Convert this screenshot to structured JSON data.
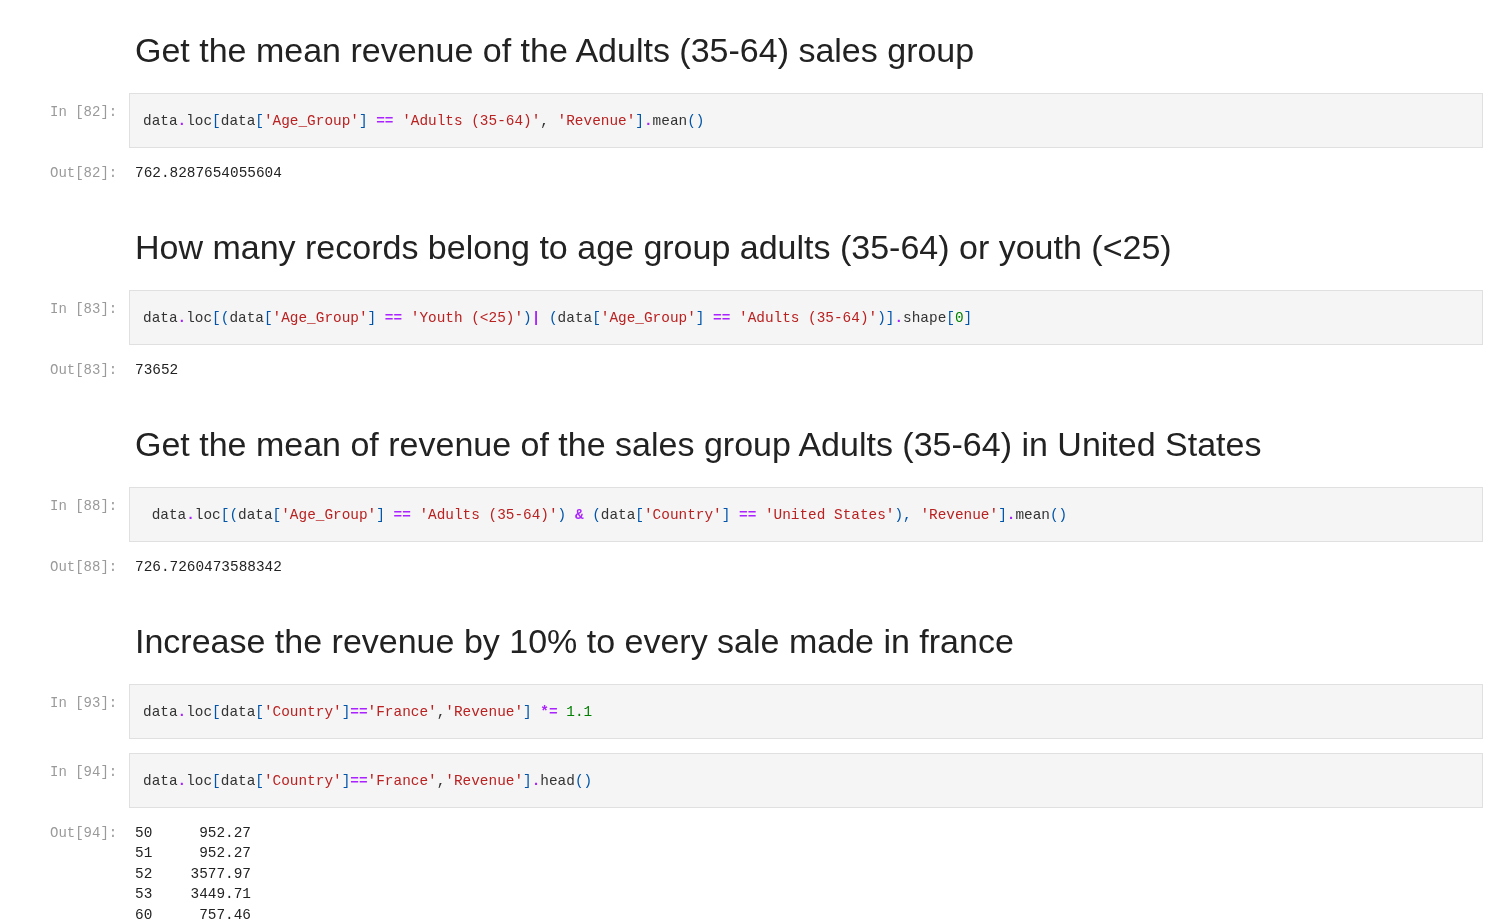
{
  "cells": [
    {
      "kind": "markdown",
      "text": "Get the mean revenue of the Adults (35-64) sales group"
    },
    {
      "kind": "code",
      "prompt": "In [82]:",
      "tokens": [
        {
          "kind": "name",
          "text": "data"
        },
        {
          "kind": "op",
          "text": "."
        },
        {
          "kind": "name",
          "text": "loc"
        },
        {
          "kind": "punc",
          "text": "["
        },
        {
          "kind": "name",
          "text": "data"
        },
        {
          "kind": "punc",
          "text": "["
        },
        {
          "kind": "str",
          "text": "'Age_Group'"
        },
        {
          "kind": "punc",
          "text": "] "
        },
        {
          "kind": "op",
          "text": "=="
        },
        {
          "kind": "str",
          "text": " 'Adults (35-64)'"
        },
        {
          "kind": "name",
          "text": ", "
        },
        {
          "kind": "str",
          "text": "'Revenue'"
        },
        {
          "kind": "punc",
          "text": "]"
        },
        {
          "kind": "op",
          "text": "."
        },
        {
          "kind": "name",
          "text": "mean"
        },
        {
          "kind": "punc",
          "text": "()"
        }
      ],
      "output": {
        "prompt": "Out[82]:",
        "lines": [
          "762.8287654055604"
        ]
      }
    },
    {
      "kind": "markdown",
      "text": "How many records belong to age group adults (35-64) or youth (<25)"
    },
    {
      "kind": "code",
      "prompt": "In [83]:",
      "tokens": [
        {
          "kind": "name",
          "text": "data"
        },
        {
          "kind": "op",
          "text": "."
        },
        {
          "kind": "name",
          "text": "loc"
        },
        {
          "kind": "punc",
          "text": "[("
        },
        {
          "kind": "name",
          "text": "data"
        },
        {
          "kind": "punc",
          "text": "["
        },
        {
          "kind": "str",
          "text": "'Age_Group'"
        },
        {
          "kind": "punc",
          "text": "] "
        },
        {
          "kind": "op",
          "text": "=="
        },
        {
          "kind": "str",
          "text": " 'Youth (<25)'"
        },
        {
          "kind": "punc",
          "text": ")"
        },
        {
          "kind": "op",
          "text": "|"
        },
        {
          "kind": "punc",
          "text": " ("
        },
        {
          "kind": "name",
          "text": "data"
        },
        {
          "kind": "punc",
          "text": "["
        },
        {
          "kind": "str",
          "text": "'Age_Group'"
        },
        {
          "kind": "punc",
          "text": "] "
        },
        {
          "kind": "op",
          "text": "=="
        },
        {
          "kind": "str",
          "text": " 'Adults (35-64)'"
        },
        {
          "kind": "punc",
          "text": ")]"
        },
        {
          "kind": "op",
          "text": "."
        },
        {
          "kind": "name",
          "text": "shape"
        },
        {
          "kind": "punc",
          "text": "["
        },
        {
          "kind": "num",
          "text": "0"
        },
        {
          "kind": "punc",
          "text": "]"
        }
      ],
      "output": {
        "prompt": "Out[83]:",
        "lines": [
          "73652"
        ]
      }
    },
    {
      "kind": "markdown",
      "text": "Get the mean of revenue of the sales group Adults (35-64) in United States"
    },
    {
      "kind": "code",
      "prompt": "In [88]:",
      "tokens": [
        {
          "kind": "name",
          "text": " data"
        },
        {
          "kind": "op",
          "text": "."
        },
        {
          "kind": "name",
          "text": "loc"
        },
        {
          "kind": "punc",
          "text": "[("
        },
        {
          "kind": "name",
          "text": "data"
        },
        {
          "kind": "punc",
          "text": "["
        },
        {
          "kind": "str",
          "text": "'Age_Group'"
        },
        {
          "kind": "punc",
          "text": "] "
        },
        {
          "kind": "op",
          "text": "=="
        },
        {
          "kind": "str",
          "text": " 'Adults (35-64)'"
        },
        {
          "kind": "punc",
          "text": ") "
        },
        {
          "kind": "op",
          "text": "&"
        },
        {
          "kind": "punc",
          "text": " ("
        },
        {
          "kind": "name",
          "text": "data"
        },
        {
          "kind": "punc",
          "text": "["
        },
        {
          "kind": "str",
          "text": "'Country'"
        },
        {
          "kind": "punc",
          "text": "] "
        },
        {
          "kind": "op",
          "text": "=="
        },
        {
          "kind": "str",
          "text": " 'United States'"
        },
        {
          "kind": "punc",
          "text": "), "
        },
        {
          "kind": "str",
          "text": "'Revenue'"
        },
        {
          "kind": "punc",
          "text": "]"
        },
        {
          "kind": "op",
          "text": "."
        },
        {
          "kind": "name",
          "text": "mean"
        },
        {
          "kind": "punc",
          "text": "()"
        }
      ],
      "output": {
        "prompt": "Out[88]:",
        "lines": [
          "726.7260473588342"
        ]
      }
    },
    {
      "kind": "markdown",
      "text": "Increase the revenue by 10% to every sale made in france"
    },
    {
      "kind": "code",
      "prompt": "In [93]:",
      "tokens": [
        {
          "kind": "name",
          "text": "data"
        },
        {
          "kind": "op",
          "text": "."
        },
        {
          "kind": "name",
          "text": "loc"
        },
        {
          "kind": "punc",
          "text": "["
        },
        {
          "kind": "name",
          "text": "data"
        },
        {
          "kind": "punc",
          "text": "["
        },
        {
          "kind": "str",
          "text": "'Country'"
        },
        {
          "kind": "punc",
          "text": "]"
        },
        {
          "kind": "op",
          "text": "=="
        },
        {
          "kind": "str",
          "text": "'France'"
        },
        {
          "kind": "name",
          "text": ","
        },
        {
          "kind": "str",
          "text": "'Revenue'"
        },
        {
          "kind": "punc",
          "text": "] "
        },
        {
          "kind": "op",
          "text": "*="
        },
        {
          "kind": "num",
          "text": " 1.1"
        }
      ]
    },
    {
      "kind": "code",
      "prompt": "In [94]:",
      "tokens": [
        {
          "kind": "name",
          "text": "data"
        },
        {
          "kind": "op",
          "text": "."
        },
        {
          "kind": "name",
          "text": "loc"
        },
        {
          "kind": "punc",
          "text": "["
        },
        {
          "kind": "name",
          "text": "data"
        },
        {
          "kind": "punc",
          "text": "["
        },
        {
          "kind": "str",
          "text": "'Country'"
        },
        {
          "kind": "punc",
          "text": "]"
        },
        {
          "kind": "op",
          "text": "=="
        },
        {
          "kind": "str",
          "text": "'France'"
        },
        {
          "kind": "name",
          "text": ","
        },
        {
          "kind": "str",
          "text": "'Revenue'"
        },
        {
          "kind": "punc",
          "text": "]"
        },
        {
          "kind": "op",
          "text": "."
        },
        {
          "kind": "name",
          "text": "head"
        },
        {
          "kind": "punc",
          "text": "()"
        }
      ],
      "output": {
        "prompt": "Out[94]:",
        "rows": [
          {
            "index": "50",
            "value": "952.27"
          },
          {
            "index": "51",
            "value": "952.27"
          },
          {
            "index": "52",
            "value": "3577.97"
          },
          {
            "index": "53",
            "value": "3449.71"
          },
          {
            "index": "60",
            "value": "757.46"
          }
        ]
      }
    }
  ]
}
